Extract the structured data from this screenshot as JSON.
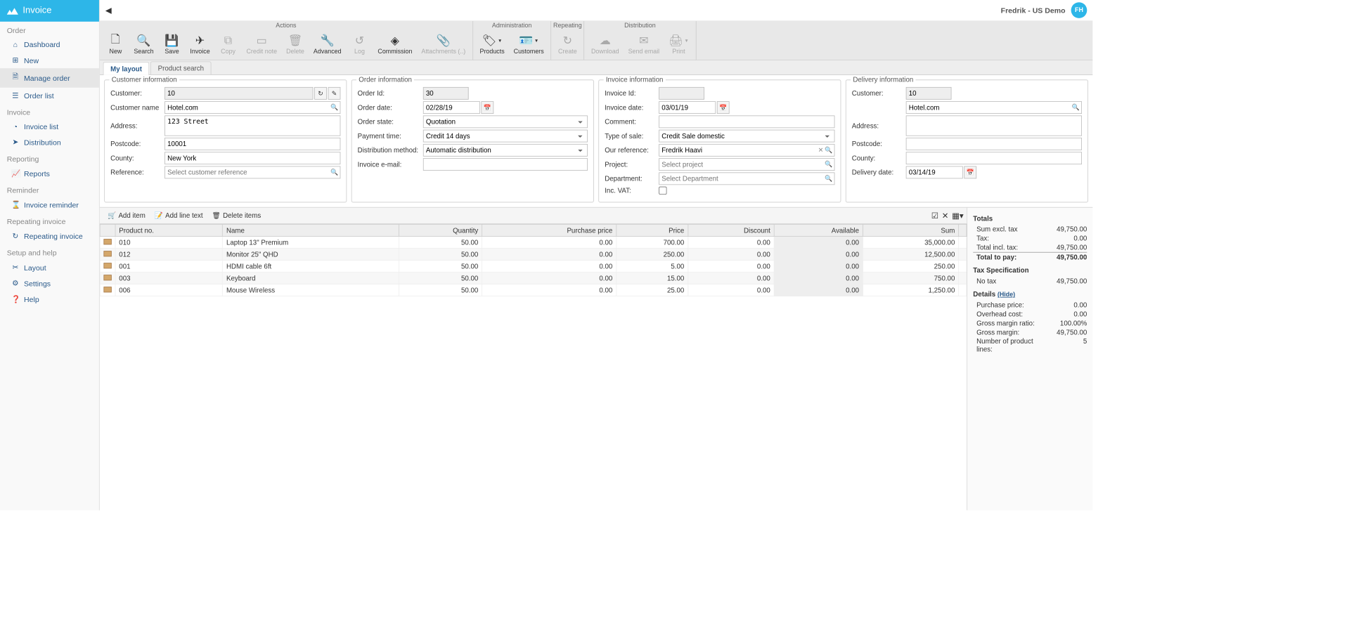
{
  "app": {
    "title": "Invoice",
    "user": "Fredrik - US Demo",
    "avatar": "FH"
  },
  "sidebar": {
    "sections": [
      {
        "title": "Order",
        "items": [
          {
            "icon": "home-icon",
            "glyph": "⌂",
            "label": "Dashboard"
          },
          {
            "icon": "plus-icon",
            "glyph": "⊞",
            "label": "New"
          },
          {
            "icon": "doc-icon",
            "glyph": "🗎",
            "label": "Manage order",
            "active": true
          },
          {
            "icon": "list-icon",
            "glyph": "☰",
            "label": "Order list"
          }
        ]
      },
      {
        "title": "Invoice",
        "items": [
          {
            "icon": "chart-icon",
            "glyph": "◔",
            "label": "Invoice list"
          },
          {
            "icon": "send-icon",
            "glyph": "➤",
            "label": "Distribution"
          }
        ]
      },
      {
        "title": "Reporting",
        "items": [
          {
            "icon": "graph-icon",
            "glyph": "📈",
            "label": "Reports"
          }
        ]
      },
      {
        "title": "Reminder",
        "items": [
          {
            "icon": "hourglass-icon",
            "glyph": "⌛",
            "label": "Invoice reminder"
          }
        ]
      },
      {
        "title": "Repeating invoice",
        "items": [
          {
            "icon": "repeat-icon",
            "glyph": "↻",
            "label": "Repeating invoice"
          }
        ]
      },
      {
        "title": "Setup and help",
        "items": [
          {
            "icon": "layout-icon",
            "glyph": "✂",
            "label": "Layout"
          },
          {
            "icon": "gear-icon",
            "glyph": "⚙",
            "label": "Settings"
          },
          {
            "icon": "help-icon",
            "glyph": "❓",
            "label": "Help"
          }
        ]
      }
    ]
  },
  "ribbon": {
    "groups": [
      {
        "title": "Actions",
        "buttons": [
          {
            "name": "new",
            "glyph": "🗋",
            "label": "New"
          },
          {
            "name": "search",
            "glyph": "🔍",
            "label": "Search"
          },
          {
            "name": "save",
            "glyph": "💾",
            "label": "Save"
          },
          {
            "name": "invoice",
            "glyph": "✈",
            "label": "Invoice"
          },
          {
            "name": "copy",
            "glyph": "⧉",
            "label": "Copy",
            "disabled": true
          },
          {
            "name": "credit-note",
            "glyph": "▭",
            "label": "Credit note",
            "disabled": true
          },
          {
            "name": "delete",
            "glyph": "🗑",
            "label": "Delete",
            "disabled": true
          },
          {
            "name": "advanced",
            "glyph": "🔧",
            "label": "Advanced"
          },
          {
            "name": "log",
            "glyph": "↺",
            "label": "Log",
            "disabled": true
          },
          {
            "name": "commission",
            "glyph": "◈",
            "label": "Commission"
          },
          {
            "name": "attachments",
            "glyph": "📎",
            "label": "Attachments (..)",
            "disabled": true
          }
        ]
      },
      {
        "title": "Administration",
        "buttons": [
          {
            "name": "products",
            "glyph": "🏷",
            "label": "Products",
            "dropdown": true
          },
          {
            "name": "customers",
            "glyph": "🪪",
            "label": "Customers",
            "dropdown": true
          }
        ]
      },
      {
        "title": "Repeating",
        "buttons": [
          {
            "name": "create",
            "glyph": "↻",
            "label": "Create",
            "disabled": true
          }
        ]
      },
      {
        "title": "Distribution",
        "buttons": [
          {
            "name": "download",
            "glyph": "☁",
            "label": "Download",
            "disabled": true
          },
          {
            "name": "send-email",
            "glyph": "✉",
            "label": "Send email",
            "disabled": true
          },
          {
            "name": "print",
            "glyph": "🖨",
            "label": "Print",
            "dropdown": true,
            "disabled": true
          }
        ]
      }
    ]
  },
  "tabs": [
    {
      "label": "My layout",
      "active": true
    },
    {
      "label": "Product search"
    }
  ],
  "customer": {
    "legend": "Customer information",
    "customer_label": "Customer:",
    "customer_value": "10",
    "name_label": "Customer name",
    "name_value": "Hotel.com",
    "address_label": "Address:",
    "address_value": "123 Street",
    "postcode_label": "Postcode:",
    "postcode_value": "10001",
    "county_label": "County:",
    "county_value": "New York",
    "reference_label": "Reference:",
    "reference_placeholder": "Select customer reference"
  },
  "order": {
    "legend": "Order information",
    "id_label": "Order Id:",
    "id_value": "30",
    "date_label": "Order date:",
    "date_value": "02/28/19",
    "state_label": "Order state:",
    "state_value": "Quotation",
    "payment_label": "Payment time:",
    "payment_value": "Credit 14 days",
    "dist_label": "Distribution method:",
    "dist_value": "Automatic distribution",
    "email_label": "Invoice e-mail:",
    "email_value": ""
  },
  "invoice": {
    "legend": "Invoice information",
    "id_label": "Invoice Id:",
    "id_value": "",
    "date_label": "Invoice date:",
    "date_value": "03/01/19",
    "comment_label": "Comment:",
    "comment_value": "",
    "type_label": "Type of sale:",
    "type_value": "Credit Sale domestic",
    "ref_label": "Our reference:",
    "ref_value": "Fredrik Haavi",
    "project_label": "Project:",
    "project_placeholder": "Select project",
    "dept_label": "Department:",
    "dept_placeholder": "Select Department",
    "vat_label": "Inc. VAT:"
  },
  "delivery": {
    "legend": "Delivery information",
    "customer_label": "Customer:",
    "customer_value": "10",
    "name_value": "Hotel.com",
    "address_label": "Address:",
    "address_value": "",
    "postcode_label": "Postcode:",
    "postcode_value": "",
    "county_label": "County:",
    "county_value": "",
    "date_label": "Delivery date:",
    "date_value": "03/14/19"
  },
  "gridToolbar": {
    "add_item": "Add item",
    "add_line": "Add line text",
    "delete_items": "Delete items"
  },
  "grid": {
    "headers": {
      "product_no": "Product no.",
      "name": "Name",
      "quantity": "Quantity",
      "purchase": "Purchase price",
      "price": "Price",
      "discount": "Discount",
      "available": "Available",
      "sum": "Sum"
    },
    "rows": [
      {
        "no": "010",
        "name": "Laptop 13\" Premium",
        "qty": "50.00",
        "purchase": "0.00",
        "price": "700.00",
        "discount": "0.00",
        "available": "0.00",
        "sum": "35,000.00"
      },
      {
        "no": "012",
        "name": "Monitor 25\" QHD",
        "qty": "50.00",
        "purchase": "0.00",
        "price": "250.00",
        "discount": "0.00",
        "available": "0.00",
        "sum": "12,500.00"
      },
      {
        "no": "001",
        "name": "HDMI cable 6ft",
        "qty": "50.00",
        "purchase": "0.00",
        "price": "5.00",
        "discount": "0.00",
        "available": "0.00",
        "sum": "250.00"
      },
      {
        "no": "003",
        "name": "Keyboard",
        "qty": "50.00",
        "purchase": "0.00",
        "price": "15.00",
        "discount": "0.00",
        "available": "0.00",
        "sum": "750.00"
      },
      {
        "no": "006",
        "name": "Mouse Wireless",
        "qty": "50.00",
        "purchase": "0.00",
        "price": "25.00",
        "discount": "0.00",
        "available": "0.00",
        "sum": "1,250.00"
      }
    ]
  },
  "totals": {
    "title": "Totals",
    "sum_excl_label": "Sum excl. tax",
    "sum_excl": "49,750.00",
    "tax_label": "Tax:",
    "tax": "0.00",
    "total_incl_label": "Total incl. tax:",
    "total_incl": "49,750.00",
    "total_pay_label": "Total to pay:",
    "total_pay": "49,750.00",
    "tax_spec_title": "Tax Specification",
    "no_tax_label": "No tax",
    "no_tax": "49,750.00",
    "details_title": "Details",
    "hide": "(Hide)",
    "purchase_label": "Purchase price:",
    "purchase": "0.00",
    "overhead_label": "Overhead cost:",
    "overhead": "0.00",
    "margin_ratio_label": "Gross margin ratio:",
    "margin_ratio": "100.00%",
    "margin_label": "Gross margin:",
    "margin": "49,750.00",
    "lines_label": "Number of product lines:",
    "lines": "5"
  }
}
